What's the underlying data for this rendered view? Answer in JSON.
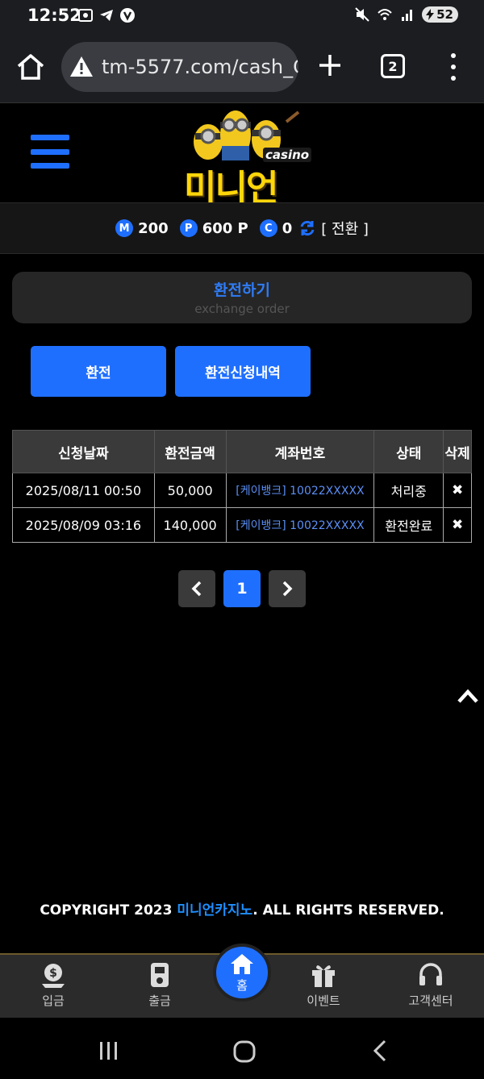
{
  "status_bar": {
    "time": "12:52",
    "battery": "52"
  },
  "browser": {
    "url": "tm-5577.com/cash_C",
    "tab_count": "2"
  },
  "site": {
    "logo_text": "미니언",
    "logo_sub": "casino"
  },
  "balance": {
    "m_badge": "M",
    "m_value": "200",
    "p_badge": "P",
    "p_value": "600 P",
    "c_badge": "C",
    "c_value": "0",
    "switch_label": "[ 전환 ]"
  },
  "page_title": {
    "main": "환전하기",
    "sub": "exchange order"
  },
  "buttons": {
    "exchange": "환전",
    "history": "환전신청내역"
  },
  "table": {
    "headers": [
      "신청날짜",
      "환전금액",
      "계좌번호",
      "상태",
      "삭제"
    ],
    "rows": [
      {
        "date": "2025/08/11 00:50",
        "amount": "50,000",
        "account": "[케이뱅크] 10022XXXXX",
        "status": "처리중",
        "delete": "✖"
      },
      {
        "date": "2025/08/09 03:16",
        "amount": "140,000",
        "account": "[케이뱅크] 10022XXXXX",
        "status": "환전완료",
        "delete": "✖"
      }
    ]
  },
  "pagination": {
    "current": "1"
  },
  "footer": {
    "copyright_prefix": "COPYRIGHT 2023 ",
    "brand": "미니언카지노",
    "copyright_suffix": ". ALL RIGHTS RESERVED."
  },
  "bottom_nav": [
    {
      "label": "입금",
      "icon": "deposit-icon"
    },
    {
      "label": "출금",
      "icon": "withdraw-icon"
    },
    {
      "label": "홈",
      "icon": "home-icon"
    },
    {
      "label": "이벤트",
      "icon": "gift-icon"
    },
    {
      "label": "고객센터",
      "icon": "headset-icon"
    }
  ],
  "colors": {
    "accent": "#1f6fff",
    "logo_yellow": "#ffd60a",
    "account_link": "#5b8ff5"
  }
}
